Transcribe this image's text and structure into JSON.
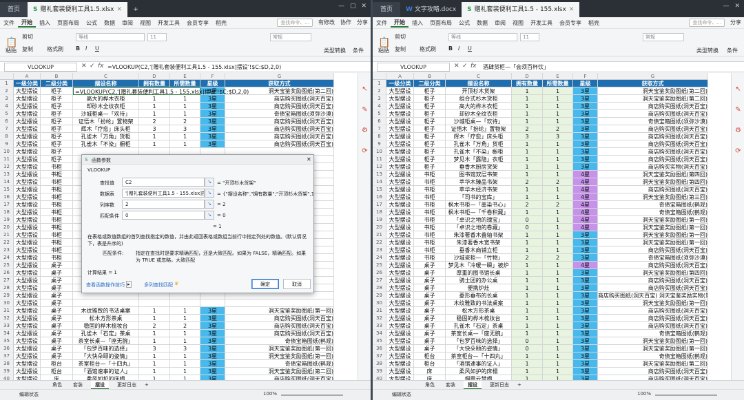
{
  "left": {
    "tabs": {
      "home": "首页",
      "file": "赠礼套装便利工具1.5.xlsx"
    },
    "menu": [
      "文件",
      "开始",
      "插入",
      "页面布局",
      "公式",
      "数据",
      "审阅",
      "视图",
      "开发工具",
      "会员专享",
      "稻壳"
    ],
    "menu_right": {
      "search": "查找命令、...",
      "unsaved": "有修改",
      "collab": "协作",
      "share": "分享"
    },
    "ribbon": {
      "cut": "剪切",
      "copy": "复制",
      "format": "格式刷",
      "paste": "粘贴",
      "convert": "类型转换",
      "cond": "条件"
    },
    "namebox": "VLOOKUP",
    "formula": "=VLOOKUP(C2,'[赠礼套装便利工具1.5 - 155.xlsx]摆设'!$C:$D,2,0)",
    "edit_cell": "=VLOOKUP(C2,'[赠礼套装便利工具1.5 - 155.xlsx]摆设'!$C:$D,2,0)",
    "columns": [
      "A",
      "B",
      "C",
      "D",
      "E",
      "F",
      "G"
    ],
    "headers": [
      "一级分类",
      "二级分类",
      "摆设名称",
      "拥有数量",
      "所需数量",
      "星级",
      "获取方式"
    ],
    "rows": [
      [
        "大型摆设",
        "柜子",
        "组合式杉木货架",
        "1",
        "1",
        "3星",
        "洞天宝鉴奖励图纸(第二回)"
      ],
      [
        "大型摆设",
        "柜子",
        "高大的桦木衣柜",
        "1",
        "1",
        "3星",
        "商店购买图纸(洞天百宝)"
      ],
      [
        "大型摆设",
        "柜子",
        "却砂木全纹衣柜",
        "1",
        "1",
        "3星",
        "商店购买图纸(洞天百宝)"
      ],
      [
        "大型摆设",
        "柜子",
        "沙城柜桌—「欢待」",
        "1",
        "1",
        "3星",
        "奇债宝箱图纸(须弥沙漠)"
      ],
      [
        "大型摆设",
        "柜子",
        "证悟木「扮纶」置物架",
        "2",
        "2",
        "3星",
        "商店购买图纸(洞天百宝)"
      ],
      [
        "大型摆设",
        "柜子",
        "辉木「疗愈」床头柜",
        "3",
        "3",
        "3星",
        "商店购买图纸(洞天百宝)"
      ],
      [
        "大型摆设",
        "柜子",
        "孔雀木「万角」货柜",
        "1",
        "1",
        "3星",
        "商店购买图纸(洞天百宝)"
      ],
      [
        "大型摆设",
        "柜子",
        "孔雀木「不染」橱柜",
        "1",
        "1",
        "3星",
        "商店购买图纸(洞天百宝)"
      ],
      [
        "大型摆设",
        "柜子",
        "",
        "",
        "",
        "",
        ""
      ],
      [
        "大型摆设",
        "柜子",
        "",
        "",
        "",
        "",
        ""
      ],
      [
        "大型摆设",
        "书柜",
        "",
        "",
        "",
        "",
        ""
      ],
      [
        "大型摆设",
        "书柜",
        "",
        "",
        "",
        "",
        ""
      ],
      [
        "大型摆设",
        "书柜",
        "",
        "",
        "",
        "",
        ""
      ],
      [
        "大型摆设",
        "书柜",
        "枫",
        "",
        "",
        "",
        ""
      ],
      [
        "大型摆设",
        "书柜",
        "枫",
        "",
        "",
        "",
        ""
      ],
      [
        "大型摆设",
        "书柜",
        "",
        "",
        "",
        "",
        ""
      ],
      [
        "大型摆设",
        "书柜",
        "",
        "",
        "",
        "",
        ""
      ],
      [
        "大型摆设",
        "书柜",
        "",
        "",
        "",
        "",
        ""
      ],
      [
        "大型摆设",
        "书柜",
        "",
        "",
        "",
        "",
        ""
      ],
      [
        "大型摆设",
        "书柜",
        "",
        "",
        "",
        "",
        ""
      ],
      [
        "大型摆设",
        "书柜",
        "",
        "",
        "",
        "",
        ""
      ],
      [
        "大型摆设",
        "书柜",
        "",
        "",
        "",
        "",
        ""
      ],
      [
        "大型摆设",
        "书柜",
        "",
        "",
        "",
        "",
        ""
      ],
      [
        "大型摆设",
        "桌子",
        "梦",
        "",
        "",
        "",
        ""
      ],
      [
        "大型摆设",
        "桌子",
        "",
        "",
        "",
        "",
        ""
      ],
      [
        "大型摆设",
        "桌子",
        "",
        "",
        "",
        "",
        ""
      ],
      [
        "大型摆设",
        "桌子",
        "",
        "",
        "",
        "",
        ""
      ],
      [
        "大型摆设",
        "桌子",
        "",
        "",
        "",
        "",
        ""
      ],
      [
        "大型摆设",
        "桌子",
        "",
        "",
        "",
        "",
        ""
      ],
      [
        "大型摆设",
        "桌子",
        "木纹雅致的书法桌案",
        "1",
        "1",
        "3星",
        "洞天宝鉴奖励图纸(第一回)"
      ],
      [
        "大型摆设",
        "桌子",
        "松木方形茶桌",
        "1",
        "1",
        "3星",
        "商店购买图纸(洞天百宝)"
      ],
      [
        "大型摆设",
        "桌子",
        "稳固的桦木梳妆台",
        "2",
        "2",
        "3星",
        "商店购买图纸(洞天百宝)"
      ],
      [
        "大型摆设",
        "桌子",
        "孔雀木「石定」茶桌",
        "1",
        "1",
        "3星",
        "商店购买图纸(洞天百宝)"
      ],
      [
        "大型摆设",
        "桌子",
        "茶室长桌—「座无腕」",
        "1",
        "1",
        "3星",
        "奇债宝箱图纸(鹤观)"
      ],
      [
        "大型摆设",
        "桌子",
        "「包罗百味的选择」",
        "3",
        "3",
        "3星",
        "洞天宝鉴奖励图纸(第一回)"
      ],
      [
        "大型摆设",
        "桌子",
        "「大快朵颐的姿情」",
        "1",
        "1",
        "3星",
        "洞天宝鉴奖励图纸(第一回)"
      ],
      [
        "大型摆设",
        "柜台",
        "茶室柜台—「十四丸」",
        "1",
        "1",
        "3星",
        "奇债宝箱图纸(鹤观)"
      ],
      [
        "大型摆设",
        "柜台",
        "「酒馆速事的证人」",
        "1",
        "1",
        "3星",
        "洞天宝鉴奖励图纸(第二回)"
      ],
      [
        "大型摆设",
        "床",
        "柔风如护的床榻",
        "1",
        "1",
        "3星",
        "商店购买图纸(洞天百宝)"
      ],
      [
        "大型摆设",
        "床",
        "烟霞云梦榻",
        "1",
        "1",
        "3星",
        "商店购买图纸(洞天百宝)"
      ],
      [
        "大型摆设",
        "床",
        "梦见木「暖眠」床榻",
        "1",
        "1",
        "3星",
        "商店购买图纸(洞天百宝)"
      ]
    ],
    "sheets": [
      "角色",
      "套装",
      "摆设",
      "更新日志"
    ],
    "status": "编辑状态",
    "zoom": "100%"
  },
  "right": {
    "tabs": {
      "home": "首页",
      "doc": "文字攻略.docx",
      "file": "赠礼套装便利工具1.5 - 155.xlsx"
    },
    "menu": [
      "文件",
      "开始",
      "插入",
      "页面布局",
      "公式",
      "数据",
      "审阅",
      "视图",
      "开发工具",
      "会员专享",
      "稻壳"
    ],
    "menu_right": {
      "search": "查找命令、...",
      "share": "分享"
    },
    "ribbon": {
      "cut": "剪切",
      "copy": "复制",
      "format": "格式刷",
      "paste": "粘贴",
      "convert": "类型转换",
      "cond": "条件"
    },
    "namebox": "VLOOKUP",
    "formula": "酒肆货柜—「会须百杯饮」",
    "columns": [
      "A",
      "B",
      "C",
      "D",
      "E",
      "F",
      "G"
    ],
    "headers": [
      "一级分类",
      "二级分类",
      "摆设名称",
      "拥有数量",
      "所需数量",
      "星级",
      "获取方式"
    ],
    "rows": [
      [
        "大型摆设",
        "柜子",
        "开顶杉木货架",
        "1",
        "1",
        "3星",
        "洞天宝鉴奖励图纸(第二回)"
      ],
      [
        "大型摆设",
        "柜子",
        "组合式杉木货柜",
        "1",
        "1",
        "3星",
        "洞天宝鉴奖励图纸(第二回)"
      ],
      [
        "大型摆设",
        "柜子",
        "高大的桦木衣柜",
        "1",
        "1",
        "3星",
        "商店购买图纸(洞天百宝)"
      ],
      [
        "大型摆设",
        "柜子",
        "却砂木全纹衣柜",
        "1",
        "1",
        "3星",
        "商店购买图纸(洞天百宝)"
      ],
      [
        "大型摆设",
        "柜子",
        "沙城柜桌—「欢待」",
        "1",
        "1",
        "3星",
        "奇债宝箱图纸(须弥沙漠)"
      ],
      [
        "大型摆设",
        "柜子",
        "证悟木「扮纶」置物架",
        "2",
        "2",
        "3星",
        "商店购买图纸(洞天百宝)"
      ],
      [
        "大型摆设",
        "柜子",
        "辉木「疗愈」床头柜",
        "3",
        "3",
        "3星",
        "商店购买图纸(洞天百宝)"
      ],
      [
        "大型摆设",
        "柜子",
        "孔雀木「万角」货柜",
        "1",
        "1",
        "3星",
        "商店购买图纸(洞天百宝)"
      ],
      [
        "大型摆设",
        "柜子",
        "孔雀木「不染」橱柜",
        "1",
        "1",
        "3星",
        "商店购买图纸(洞天百宝)"
      ],
      [
        "大型摆设",
        "柜子",
        "梦见木「露隐」衣柜",
        "1",
        "1",
        "3星",
        "商店购买图纸(洞天百宝)"
      ],
      [
        "大型摆设",
        "柜子",
        "垂香木厨房货架",
        "1",
        "1",
        "3星",
        "商店购买实物(洞天百宝)"
      ],
      [
        "大型摆设",
        "书柜",
        "图书馆双层书架",
        "1",
        "1",
        "4星",
        "洞天宝鉴奖励图纸(第四回)"
      ],
      [
        "大型摆设",
        "书柜",
        "萃华木臻品书架",
        "2",
        "2",
        "4星",
        "洞天宝鉴奖励图纸(第四回)"
      ],
      [
        "大型摆设",
        "书柜",
        "萃华木经济书架",
        "1",
        "1",
        "4星",
        "商店购买图纸(洞天百宝)"
      ],
      [
        "大型摆设",
        "书柜",
        "「司书的宝库」",
        "1",
        "1",
        "4星",
        "洞天宝鉴奖励图纸(第三回)"
      ],
      [
        "大型摆设",
        "书柜",
        "枫木书柜—「墨染书心」",
        "2",
        "2",
        "4星",
        "奇债宝箱图纸(鹤观)"
      ],
      [
        "大型摆设",
        "书柜",
        "枫木书柜—「千卷积藏」",
        "1",
        "1",
        "4星",
        "奇债宝箱图纸(鹤观)"
      ],
      [
        "大型摆设",
        "书柜",
        "「卓识之地的瑰宝」",
        "0",
        "1",
        "4星",
        "洞天宝鉴奖励图纸(第一回)"
      ],
      [
        "大型摆设",
        "书柜",
        "「卓识之地的卷藏」",
        "0",
        "1",
        "4星",
        "洞天宝鉴奖励图纸(第一回)"
      ],
      [
        "大型摆设",
        "书柜",
        "朱漆著香木叠轴书架",
        "1",
        "1",
        "3星",
        "洞天宝鉴奖励图纸(第一回)"
      ],
      [
        "大型摆设",
        "书柜",
        "朱漆著香木宽书架",
        "1",
        "1",
        "3星",
        "洞天宝鉴奖励图纸(第一回)"
      ],
      [
        "大型摆设",
        "书柜",
        "垂香木商铺立柜",
        "1",
        "1",
        "3星",
        "商店购买图纸(洞天百宝)"
      ],
      [
        "大型摆设",
        "书柜",
        "沙城瓷柜—「竹物」",
        "2",
        "2",
        "3星",
        "奇债宝箱图纸(须弥沙漠)"
      ],
      [
        "大型摆设",
        "桌子",
        "梦见木「冷暖一瞬」被炉",
        "1",
        "1",
        "4星",
        "商店购买图纸(洞天百宝)"
      ],
      [
        "大型摆设",
        "桌子",
        "厚重的图书馆长桌",
        "1",
        "1",
        "3星",
        "洞天宝鉴奖励图纸(第四回)"
      ],
      [
        "大型摆设",
        "桌子",
        "骑士团的办公桌",
        "1",
        "1",
        "3星",
        "商店购买图纸(洞天百宝)"
      ],
      [
        "大型摆设",
        "桌子",
        "便携炉灶",
        "1",
        "1",
        "3星",
        "商店购买图纸(洞天百宝)"
      ],
      [
        "大型摆设",
        "桌子",
        "菱形垂布的长桌",
        "1",
        "1",
        "3星",
        "商店购买图纸(洞天百宝) 洞天宝鉴奖励实物(第"
      ],
      [
        "大型摆设",
        "桌子",
        "木纹雅致的书法桌案",
        "1",
        "1",
        "3星",
        "洞天宝鉴奖励图纸(第一回)"
      ],
      [
        "大型摆设",
        "桌子",
        "松木方形茶桌",
        "1",
        "1",
        "3星",
        "商店购买图纸(洞天百宝)"
      ],
      [
        "大型摆设",
        "桌子",
        "稳固的桦木梳妆台",
        "1",
        "1",
        "3星",
        "商店购买图纸(洞天百宝)"
      ],
      [
        "大型摆设",
        "桌子",
        "孔雀木「石定」茶桌",
        "1",
        "1",
        "3星",
        "商店购买图纸(洞天百宝)"
      ],
      [
        "大型摆设",
        "桌子",
        "茶室长桌—「座无腕」",
        "1",
        "1",
        "3星",
        "奇债宝箱图纸(鹤观)"
      ],
      [
        "大型摆设",
        "桌子",
        "「包罗百味的选择」",
        "0",
        "1",
        "3星",
        "洞天宝鉴奖励图纸(第一回)"
      ],
      [
        "大型摆设",
        "桌子",
        "「大快朵颐的姿情」",
        "0",
        "1",
        "3星",
        "洞天宝鉴奖励图纸(第一回)"
      ],
      [
        "大型摆设",
        "柜台",
        "茶室柜台—「十四丸」",
        "1",
        "1",
        "3星",
        "奇债宝箱图纸(鹤观)"
      ],
      [
        "大型摆设",
        "柜台",
        "「酒馆速事的证人」",
        "1",
        "1",
        "3星",
        "洞天宝鉴奖励图纸(第二回)"
      ],
      [
        "大型摆设",
        "床",
        "柔风如护的床榻",
        "1",
        "1",
        "3星",
        "商店购买图纸(洞天百宝)"
      ],
      [
        "大型摆设",
        "床",
        "烟霞云梦榻",
        "1",
        "1",
        "3星",
        "商店购买图纸(洞天百宝)"
      ],
      [
        "大型摆设",
        "床",
        "梦见木「暖眠」床榻",
        "1",
        "1",
        "3星",
        "商店购买图纸(洞天百宝)"
      ]
    ],
    "sheets": [
      "角色",
      "套装",
      "摆设",
      "更新日志"
    ],
    "status": "编辑状态",
    "zoom": "100%"
  },
  "dialog": {
    "title": "函数参数",
    "func": "VLOOKUP",
    "args": [
      {
        "label": "查找值",
        "value": "C2",
        "result": "= \"开顶杉木货架\""
      },
      {
        "label": "数据表",
        "value": "'[赠礼套装便利工具1.5 - 155.xlsx]摆设'!",
        "result": "= {\"摆设名称\",\"拥有数量\";\"开顶杉木货架\",1..."
      },
      {
        "label": "列序数",
        "value": "2",
        "result": "= 2"
      },
      {
        "label": "匹配条件",
        "value": "0",
        "result": "= 0"
      }
    ],
    "overall_result": "= 1",
    "description": "在表格或数值数组的首列查找指定的数值，并由此返回表格或数组当前行中指定列处的数值。(默认情况下，表是升序的)",
    "param_help_label": "匹配条件:",
    "param_help": "指定在查找时是要求精确匹配，还是大致匹配。如果为 FALSE，精确匹配。如果为 TRUE 或忽略，大致匹配",
    "calc_result": "计算结果 = 1",
    "tips_link": "查看函数操作技巧",
    "multi_link": "多列查找匹配",
    "ok": "确定",
    "cancel": "取消"
  },
  "colors": {
    "header_blue": "#1f6fb0",
    "star3": "#47b9ec",
    "star4": "#c792ea",
    "green": "#e8f4e0",
    "titlebar": "#2b3037"
  }
}
